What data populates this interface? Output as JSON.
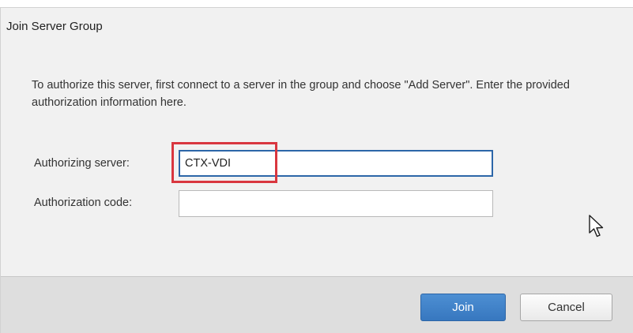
{
  "dialog": {
    "title": "Join Server Group",
    "description": "To authorize this server, first connect to a server in the group and choose \"Add Server\". Enter the provided authorization information here."
  },
  "fields": {
    "authorizing_server": {
      "label": "Authorizing server:",
      "value": "CTX-VDI"
    },
    "authorization_code": {
      "label": "Authorization code:",
      "value": ""
    }
  },
  "buttons": {
    "join_label": "Join",
    "cancel_label": "Cancel"
  },
  "icons": {
    "cursor": "mouse-pointer-icon"
  },
  "colors": {
    "accent": "#3777bf",
    "highlight": "#d9363f",
    "dialog_background": "#f1f1f1",
    "footer_background": "#dedede"
  }
}
